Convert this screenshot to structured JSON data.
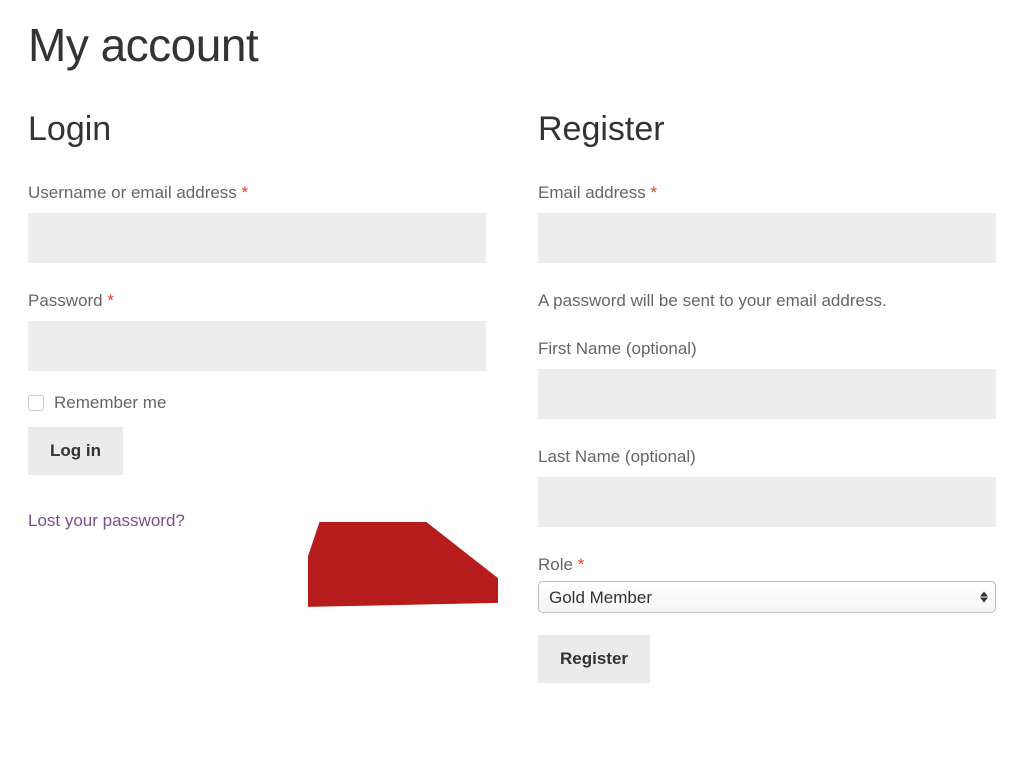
{
  "page": {
    "title": "My account"
  },
  "login": {
    "heading": "Login",
    "username_label": "Username or email address",
    "password_label": "Password",
    "remember_label": "Remember me",
    "submit_label": "Log in",
    "lost_password_text": "Lost your password?",
    "required_indicator": "*",
    "username_value": "",
    "password_value": ""
  },
  "register": {
    "heading": "Register",
    "email_label": "Email address",
    "password_notice": "A password will be sent to your email address.",
    "first_name_label": "First Name (optional)",
    "last_name_label": "Last Name (optional)",
    "role_label": "Role",
    "role_selected": "Gold Member",
    "submit_label": "Register",
    "required_indicator": "*",
    "email_value": "",
    "first_name_value": "",
    "last_name_value": ""
  },
  "colors": {
    "required": "#e2401c",
    "link": "#7a4f8e",
    "input_bg": "#ededed",
    "button_bg": "#ebebeb",
    "text_muted": "#666666",
    "annotation_arrow": "#b71c1c"
  }
}
